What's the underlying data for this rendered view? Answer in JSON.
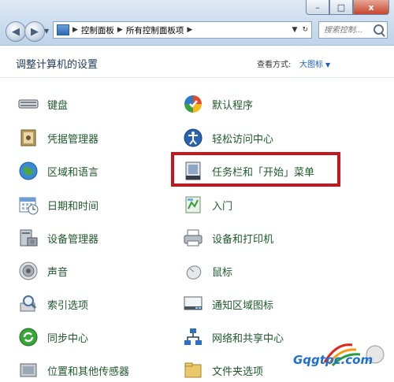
{
  "window": {
    "minimize_label": "–",
    "maximize_label": "□",
    "close_label": "x"
  },
  "nav": {
    "back_icon": "◀",
    "forward_icon": "▶"
  },
  "address": {
    "crumbs": [
      "控制面板",
      "所有控制面板项"
    ]
  },
  "search": {
    "placeholder": "搜索控制..."
  },
  "header": {
    "title": "调整计算机的设置",
    "view_label": "查看方式:",
    "view_value": "大图标"
  },
  "items_left": [
    {
      "label": "键盘",
      "icon": "keyboard-icon"
    },
    {
      "label": "凭据管理器",
      "icon": "credential-manager-icon"
    },
    {
      "label": "区域和语言",
      "icon": "globe-icon"
    },
    {
      "label": "日期和时间",
      "icon": "calendar-clock-icon"
    },
    {
      "label": "设备管理器",
      "icon": "device-manager-icon"
    },
    {
      "label": "声音",
      "icon": "speaker-icon"
    },
    {
      "label": "索引选项",
      "icon": "index-options-icon"
    },
    {
      "label": "同步中心",
      "icon": "sync-icon"
    },
    {
      "label": "位置和其他传感器",
      "icon": "sensor-icon"
    }
  ],
  "items_right": [
    {
      "label": "默认程序",
      "icon": "default-programs-icon"
    },
    {
      "label": "轻松访问中心",
      "icon": "ease-of-access-icon"
    },
    {
      "label": "任务栏和「开始」菜单",
      "icon": "taskbar-icon"
    },
    {
      "label": "入门",
      "icon": "getting-started-icon"
    },
    {
      "label": "设备和打印机",
      "icon": "printer-icon"
    },
    {
      "label": "鼠标",
      "icon": "mouse-icon"
    },
    {
      "label": "通知区域图标",
      "icon": "notification-area-icon"
    },
    {
      "label": "网络和共享中心",
      "icon": "network-icon"
    },
    {
      "label": "文件夹选项",
      "icon": "folder-options-icon"
    }
  ],
  "watermark": {
    "text": "Gqgtpc.com"
  },
  "colors": {
    "link_green": "#1e5a2c",
    "highlight_red": "#c4161c"
  }
}
